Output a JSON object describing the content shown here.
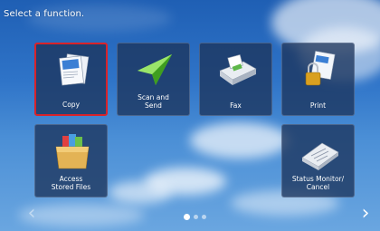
{
  "prompt": "Select a function.",
  "tiles": [
    {
      "label": "Copy",
      "icon": "copy-icon",
      "selected": true
    },
    {
      "label": "Scan and\nSend",
      "icon": "scan-send-icon"
    },
    {
      "label": "Fax",
      "icon": "fax-icon"
    },
    {
      "label": "Print",
      "icon": "print-icon"
    },
    {
      "label": "Access\nStored Files",
      "icon": "folder-icon"
    },
    {
      "label": "Status Monitor/\nCancel",
      "icon": "status-monitor-icon"
    }
  ],
  "pagination": {
    "page_count": 3,
    "current_page": 1
  },
  "colors": {
    "selected_border": "#d8232a",
    "tile_bg": "#1c345c"
  }
}
